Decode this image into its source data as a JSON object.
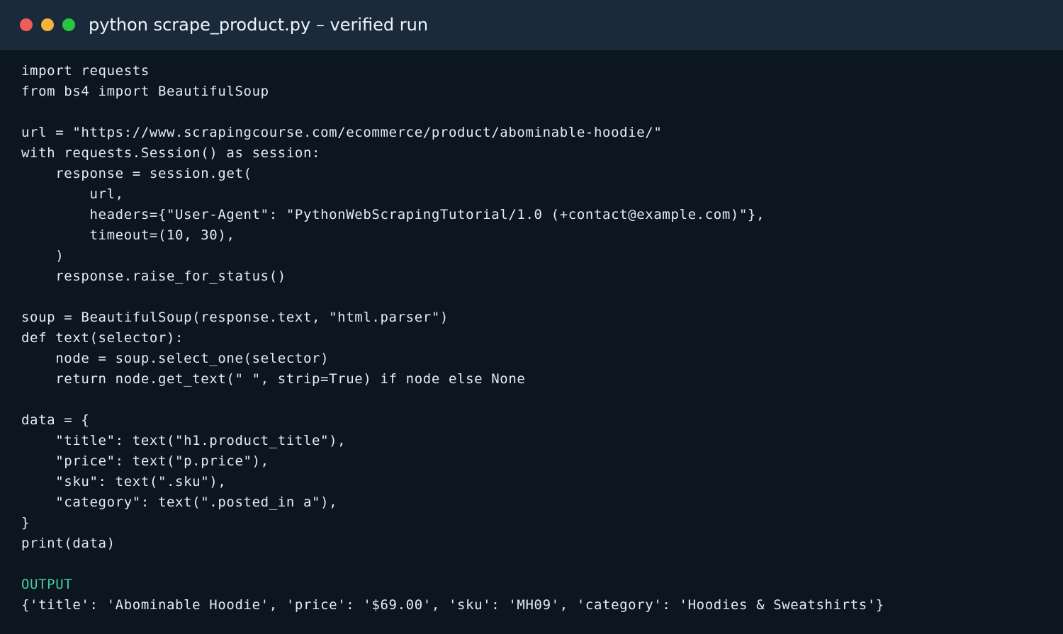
{
  "window": {
    "title": "python scrape_product.py – verified run",
    "controls": [
      {
        "name": "close",
        "color": "#ef5d5a"
      },
      {
        "name": "minimize",
        "color": "#f4b43c"
      },
      {
        "name": "zoom",
        "color": "#27c540"
      }
    ]
  },
  "code": {
    "lines": [
      "import requests",
      "from bs4 import BeautifulSoup",
      "",
      "url = \"https://www.scrapingcourse.com/ecommerce/product/abominable-hoodie/\"",
      "with requests.Session() as session:",
      "    response = session.get(",
      "        url,",
      "        headers={\"User-Agent\": \"PythonWebScrapingTutorial/1.0 (+contact@example.com)\"},",
      "        timeout=(10, 30),",
      "    )",
      "    response.raise_for_status()",
      "",
      "soup = BeautifulSoup(response.text, \"html.parser\")",
      "def text(selector):",
      "    node = soup.select_one(selector)",
      "    return node.get_text(\" \", strip=True) if node else None",
      "",
      "data = {",
      "    \"title\": text(\"h1.product_title\"),",
      "    \"price\": text(\"p.price\"),",
      "    \"sku\": text(\".sku\"),",
      "    \"category\": text(\".posted_in a\"),",
      "}",
      "print(data)",
      ""
    ]
  },
  "output": {
    "label": "OUTPUT",
    "result": "{'title': 'Abominable Hoodie', 'price': '$69.00', 'sku': 'MH09', 'category': 'Hoodies & Sweatshirts'}"
  },
  "colors": {
    "background": "#0c1621",
    "titlebar": "#1b2a3b",
    "text": "#e6ebf1",
    "output_label": "#4ec9a0"
  }
}
